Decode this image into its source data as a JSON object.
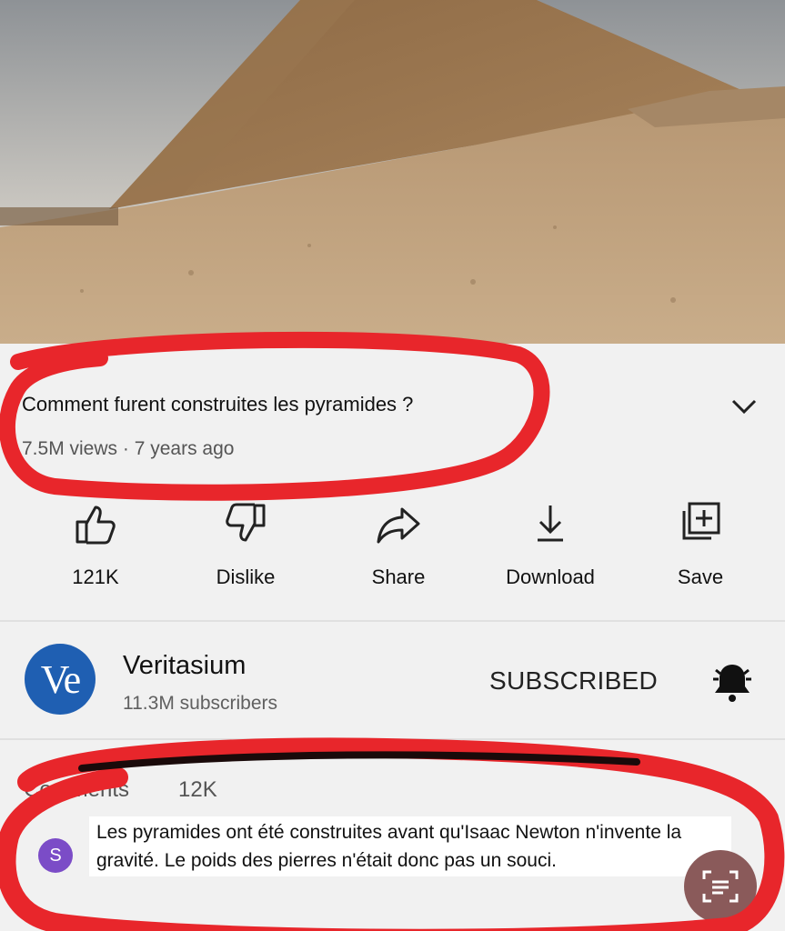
{
  "video": {
    "title": "Comment furent construites les pyramides ?",
    "views": "7.5M views",
    "age": "7 years ago"
  },
  "actions": [
    {
      "label": "121K",
      "icon": "thumbs-up-icon"
    },
    {
      "label": "Dislike",
      "icon": "thumbs-down-icon"
    },
    {
      "label": "Share",
      "icon": "share-icon"
    },
    {
      "label": "Download",
      "icon": "download-icon"
    },
    {
      "label": "Save",
      "icon": "save-to-playlist-icon"
    }
  ],
  "channel": {
    "avatar_text": "Ve",
    "name": "Veritasium",
    "subscribers": "11.3M subscribers",
    "subscribe_state": "SUBSCRIBED"
  },
  "comments": {
    "header": "Comments",
    "count": "12K",
    "top_comment": {
      "avatar_letter": "S",
      "text": "Les pyramides ont été construites avant qu'Isaac Newton n'invente la gravité. Le poids des pierres n'était donc pas un souci."
    }
  },
  "colors": {
    "annotation_red": "#e8262b",
    "channel_blue": "#1f5fb2"
  }
}
